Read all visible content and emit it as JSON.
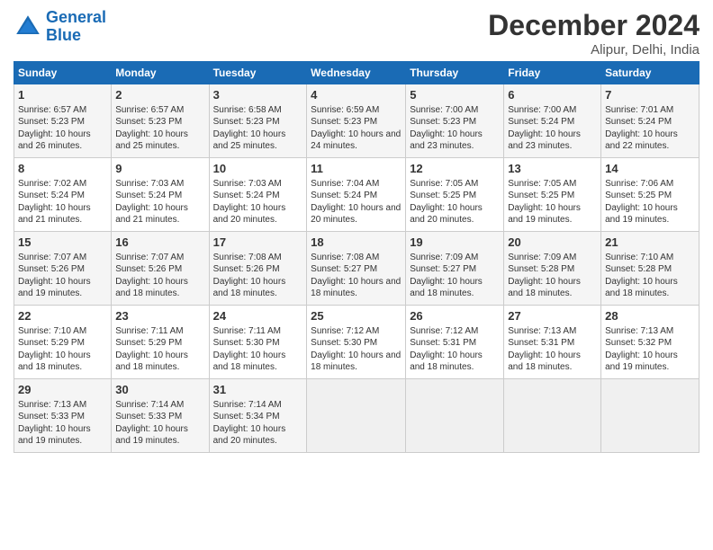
{
  "header": {
    "logo_text_part1": "General",
    "logo_text_part2": "Blue",
    "month": "December 2024",
    "location": "Alipur, Delhi, India"
  },
  "days_of_week": [
    "Sunday",
    "Monday",
    "Tuesday",
    "Wednesday",
    "Thursday",
    "Friday",
    "Saturday"
  ],
  "weeks": [
    [
      {
        "day": 1,
        "lines": [
          "Sunrise: 6:57 AM",
          "Sunset: 5:23 PM",
          "Daylight: 10 hours",
          "and 26 minutes."
        ]
      },
      {
        "day": 2,
        "lines": [
          "Sunrise: 6:57 AM",
          "Sunset: 5:23 PM",
          "Daylight: 10 hours",
          "and 25 minutes."
        ]
      },
      {
        "day": 3,
        "lines": [
          "Sunrise: 6:58 AM",
          "Sunset: 5:23 PM",
          "Daylight: 10 hours",
          "and 25 minutes."
        ]
      },
      {
        "day": 4,
        "lines": [
          "Sunrise: 6:59 AM",
          "Sunset: 5:23 PM",
          "Daylight: 10 hours",
          "and 24 minutes."
        ]
      },
      {
        "day": 5,
        "lines": [
          "Sunrise: 7:00 AM",
          "Sunset: 5:23 PM",
          "Daylight: 10 hours",
          "and 23 minutes."
        ]
      },
      {
        "day": 6,
        "lines": [
          "Sunrise: 7:00 AM",
          "Sunset: 5:24 PM",
          "Daylight: 10 hours",
          "and 23 minutes."
        ]
      },
      {
        "day": 7,
        "lines": [
          "Sunrise: 7:01 AM",
          "Sunset: 5:24 PM",
          "Daylight: 10 hours",
          "and 22 minutes."
        ]
      }
    ],
    [
      {
        "day": 8,
        "lines": [
          "Sunrise: 7:02 AM",
          "Sunset: 5:24 PM",
          "Daylight: 10 hours",
          "and 21 minutes."
        ]
      },
      {
        "day": 9,
        "lines": [
          "Sunrise: 7:03 AM",
          "Sunset: 5:24 PM",
          "Daylight: 10 hours",
          "and 21 minutes."
        ]
      },
      {
        "day": 10,
        "lines": [
          "Sunrise: 7:03 AM",
          "Sunset: 5:24 PM",
          "Daylight: 10 hours",
          "and 20 minutes."
        ]
      },
      {
        "day": 11,
        "lines": [
          "Sunrise: 7:04 AM",
          "Sunset: 5:24 PM",
          "Daylight: 10 hours",
          "and 20 minutes."
        ]
      },
      {
        "day": 12,
        "lines": [
          "Sunrise: 7:05 AM",
          "Sunset: 5:25 PM",
          "Daylight: 10 hours",
          "and 20 minutes."
        ]
      },
      {
        "day": 13,
        "lines": [
          "Sunrise: 7:05 AM",
          "Sunset: 5:25 PM",
          "Daylight: 10 hours",
          "and 19 minutes."
        ]
      },
      {
        "day": 14,
        "lines": [
          "Sunrise: 7:06 AM",
          "Sunset: 5:25 PM",
          "Daylight: 10 hours",
          "and 19 minutes."
        ]
      }
    ],
    [
      {
        "day": 15,
        "lines": [
          "Sunrise: 7:07 AM",
          "Sunset: 5:26 PM",
          "Daylight: 10 hours",
          "and 19 minutes."
        ]
      },
      {
        "day": 16,
        "lines": [
          "Sunrise: 7:07 AM",
          "Sunset: 5:26 PM",
          "Daylight: 10 hours",
          "and 18 minutes."
        ]
      },
      {
        "day": 17,
        "lines": [
          "Sunrise: 7:08 AM",
          "Sunset: 5:26 PM",
          "Daylight: 10 hours",
          "and 18 minutes."
        ]
      },
      {
        "day": 18,
        "lines": [
          "Sunrise: 7:08 AM",
          "Sunset: 5:27 PM",
          "Daylight: 10 hours",
          "and 18 minutes."
        ]
      },
      {
        "day": 19,
        "lines": [
          "Sunrise: 7:09 AM",
          "Sunset: 5:27 PM",
          "Daylight: 10 hours",
          "and 18 minutes."
        ]
      },
      {
        "day": 20,
        "lines": [
          "Sunrise: 7:09 AM",
          "Sunset: 5:28 PM",
          "Daylight: 10 hours",
          "and 18 minutes."
        ]
      },
      {
        "day": 21,
        "lines": [
          "Sunrise: 7:10 AM",
          "Sunset: 5:28 PM",
          "Daylight: 10 hours",
          "and 18 minutes."
        ]
      }
    ],
    [
      {
        "day": 22,
        "lines": [
          "Sunrise: 7:10 AM",
          "Sunset: 5:29 PM",
          "Daylight: 10 hours",
          "and 18 minutes."
        ]
      },
      {
        "day": 23,
        "lines": [
          "Sunrise: 7:11 AM",
          "Sunset: 5:29 PM",
          "Daylight: 10 hours",
          "and 18 minutes."
        ]
      },
      {
        "day": 24,
        "lines": [
          "Sunrise: 7:11 AM",
          "Sunset: 5:30 PM",
          "Daylight: 10 hours",
          "and 18 minutes."
        ]
      },
      {
        "day": 25,
        "lines": [
          "Sunrise: 7:12 AM",
          "Sunset: 5:30 PM",
          "Daylight: 10 hours",
          "and 18 minutes."
        ]
      },
      {
        "day": 26,
        "lines": [
          "Sunrise: 7:12 AM",
          "Sunset: 5:31 PM",
          "Daylight: 10 hours",
          "and 18 minutes."
        ]
      },
      {
        "day": 27,
        "lines": [
          "Sunrise: 7:13 AM",
          "Sunset: 5:31 PM",
          "Daylight: 10 hours",
          "and 18 minutes."
        ]
      },
      {
        "day": 28,
        "lines": [
          "Sunrise: 7:13 AM",
          "Sunset: 5:32 PM",
          "Daylight: 10 hours",
          "and 19 minutes."
        ]
      }
    ],
    [
      {
        "day": 29,
        "lines": [
          "Sunrise: 7:13 AM",
          "Sunset: 5:33 PM",
          "Daylight: 10 hours",
          "and 19 minutes."
        ]
      },
      {
        "day": 30,
        "lines": [
          "Sunrise: 7:14 AM",
          "Sunset: 5:33 PM",
          "Daylight: 10 hours",
          "and 19 minutes."
        ]
      },
      {
        "day": 31,
        "lines": [
          "Sunrise: 7:14 AM",
          "Sunset: 5:34 PM",
          "Daylight: 10 hours",
          "and 20 minutes."
        ]
      },
      null,
      null,
      null,
      null
    ]
  ]
}
